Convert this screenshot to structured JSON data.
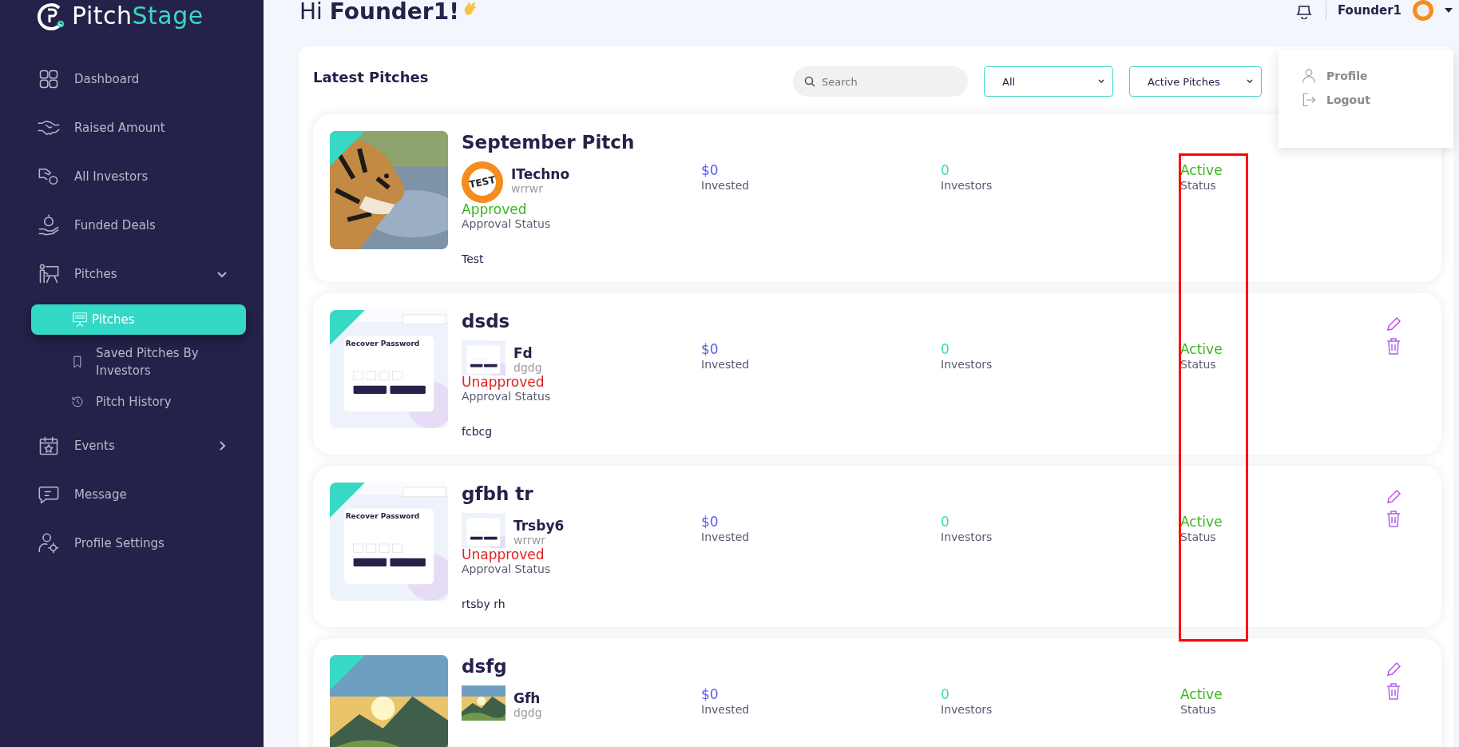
{
  "brand": {
    "parts": [
      "Pitch",
      "Stage"
    ]
  },
  "sidebar": {
    "items": [
      {
        "label": "Dashboard",
        "kind": "dashboard",
        "selected": false
      },
      {
        "label": "Raised Amount",
        "kind": "handshake",
        "selected": false
      },
      {
        "label": "All Investors",
        "kind": "hand-coin",
        "selected": false
      },
      {
        "label": "Funded Deals",
        "kind": "coin-hand",
        "selected": false
      },
      {
        "label": "Pitches",
        "kind": "presenter",
        "selected": false,
        "expanded": true,
        "children": [
          {
            "label": "Pitches",
            "kind": "board",
            "selected": true
          },
          {
            "label": "Saved Pitches By Investors",
            "kind": "bookmark",
            "selected": false
          },
          {
            "label": "Pitch History",
            "kind": "history",
            "selected": false
          }
        ]
      },
      {
        "label": "Events",
        "kind": "calendar",
        "selected": false,
        "expanded": false
      },
      {
        "label": "Message",
        "kind": "chat",
        "selected": false
      },
      {
        "label": "Profile Settings",
        "kind": "user-gear",
        "selected": false
      }
    ]
  },
  "header": {
    "greeting": "Hi **Founder1!**",
    "user_name": "Founder1"
  },
  "user_menu": {
    "expanded": true,
    "items": [
      {
        "label": "Profile",
        "kind": "profile"
      },
      {
        "label": "Logout",
        "kind": "logout"
      }
    ]
  },
  "panel": {
    "title": "Latest Pitches",
    "search": {
      "placeholder": "Search"
    },
    "filters": [
      {
        "value": "All"
      },
      {
        "value": "Active Pitches"
      }
    ]
  },
  "pitches": [
    {
      "title": "September Pitch",
      "owner_logo_text": "TEST",
      "owner_name": "ITechno",
      "owner_sub": "wrrwr",
      "approval": "Approved",
      "approved": true,
      "approval_label": "Approval Status",
      "description": "Test",
      "invested": "$0",
      "invested_label": "Invested",
      "investors": "0",
      "investors_label": "Investors",
      "status": "Active",
      "status_label": "Status",
      "actions": false
    },
    {
      "title": "dsds",
      "preview_title": "Recover Password",
      "owner_name": "Fd",
      "owner_sub": "dgdg",
      "approval": "Unapproved",
      "approved": false,
      "approval_label": "Approval Status",
      "description": "fcbcg",
      "invested": "$0",
      "invested_label": "Invested",
      "investors": "0",
      "investors_label": "Investors",
      "status": "Active",
      "status_label": "Status",
      "actions": true
    },
    {
      "title": "gfbh tr",
      "preview_title": "Recover Password",
      "owner_name": "Trsby6",
      "owner_sub": "wrrwr",
      "approval": "Unapproved",
      "approved": false,
      "approval_label": "Approval Status",
      "description": "rtsby rh",
      "invested": "$0",
      "invested_label": "Invested",
      "investors": "0",
      "investors_label": "Investors",
      "status": "Active",
      "status_label": "Status",
      "actions": true
    },
    {
      "title": "dsfg",
      "owner_name": "Gfh",
      "owner_sub": "dgdg",
      "invested": "$0",
      "invested_label": "Invested",
      "investors": "0",
      "investors_label": "Investors",
      "status": "Active",
      "status_label": "Status",
      "actions": true
    }
  ]
}
